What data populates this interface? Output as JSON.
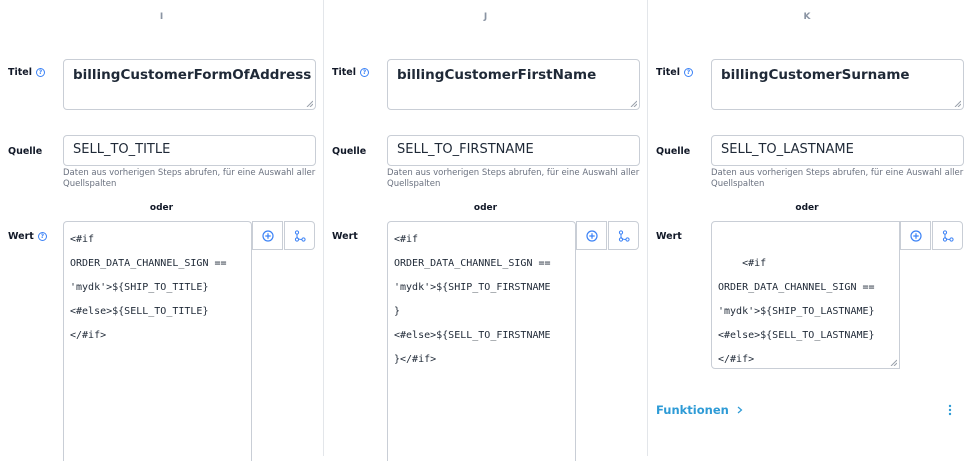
{
  "columns": [
    {
      "header": "I",
      "title_label": "Titel",
      "title_value": "billingCustomerFormOfAddress",
      "source_label": "Quelle",
      "source_value": "SELL_TO_TITLE",
      "hint": "Daten aus vorherigen Steps abrufen, für eine Auswahl aller Quellspalten",
      "or_label": "oder",
      "value_label": "Wert",
      "value_code": "<#if\nORDER_DATA_CHANNEL_SIGN ==\n'mydk'>${SHIP_TO_TITLE}\n<#else>${SELL_TO_TITLE}\n</#if>"
    },
    {
      "header": "J",
      "title_label": "Titel",
      "title_value": "billingCustomerFirstName",
      "source_label": "Quelle",
      "source_value": "SELL_TO_FIRSTNAME",
      "hint": "Daten aus vorherigen Steps abrufen, für eine Auswahl aller Quellspalten",
      "or_label": "oder",
      "value_label": "Wert",
      "value_code": "<#if\nORDER_DATA_CHANNEL_SIGN ==\n'mydk'>${SHIP_TO_FIRSTNAME\n}\n<#else>${SELL_TO_FIRSTNAME\n}</#if>"
    },
    {
      "header": "K",
      "title_label": "Titel",
      "title_value": "billingCustomerSurname",
      "source_label": "Quelle",
      "source_value": "SELL_TO_LASTNAME",
      "hint": "Daten aus vorherigen Steps abrufen, für eine Auswahl aller Quellspalten",
      "or_label": "oder",
      "value_label": "Wert",
      "value_code": "<#if\nORDER_DATA_CHANNEL_SIGN ==\n'mydk'>${SHIP_TO_LASTNAME}\n<#else>${SELL_TO_LASTNAME}\n</#if>",
      "functions_label": "Funktionen"
    }
  ],
  "icons": {
    "info": "info-circle-icon",
    "add": "plus-circle-icon",
    "mapping": "tree-branch-icon",
    "expand": "caret-right-icon",
    "more": "kebab-menu-icon"
  },
  "colors": {
    "accent": "#3b82f6",
    "link": "#2e9bd6",
    "border": "#c9ced6",
    "hint": "#6b7280"
  }
}
